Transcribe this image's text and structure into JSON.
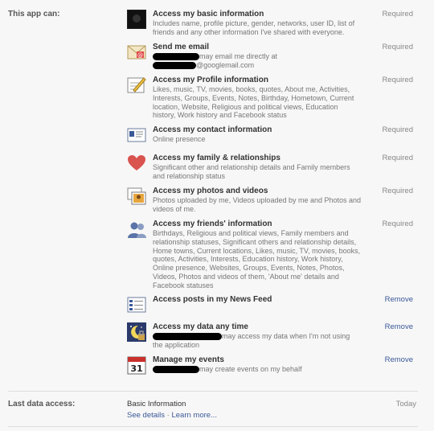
{
  "section_label": "This app can:",
  "permissions": [
    {
      "title": "Access my basic information",
      "desc": "Includes name, profile picture, gender, networks, user ID, list of friends and any other information I've shared with everyone.",
      "status": "Required"
    },
    {
      "title": "Send me email",
      "desc": "may email me directly at",
      "desc2": "@googlemail.com",
      "status": "Required"
    },
    {
      "title": "Access my Profile information",
      "desc": "Likes, music, TV, movies, books, quotes, About me, Activities, Interests, Groups, Events, Notes, Birthday, Hometown, Current location, Website, Religious and political views, Education history, Work history and Facebook status",
      "status": "Required"
    },
    {
      "title": "Access my contact information",
      "desc": "Online presence",
      "status": "Required"
    },
    {
      "title": "Access my family & relationships",
      "desc": "Significant other and relationship details and Family members and relationship status",
      "status": "Required"
    },
    {
      "title": "Access my photos and videos",
      "desc": "Photos uploaded by me, Videos uploaded by me and Photos and videos of me.",
      "status": "Required"
    },
    {
      "title": "Access my friends' information",
      "desc": "Birthdays, Religious and political views, Family members and relationship statuses, Significant others and relationship details, Home towns, Current locations, Likes, music, TV, movies, books, quotes, Activities, Interests, Education history, Work history, Online presence, Websites, Groups, Events, Notes, Photos, Videos, Photos and videos of them, 'About me' details and Facebook statuses",
      "status": "Required"
    },
    {
      "title": "Access posts in my News Feed",
      "desc": "",
      "status": "Remove"
    },
    {
      "title": "Access my data any time",
      "desc": "may access my data when I'm not using the application",
      "status": "Remove"
    },
    {
      "title": "Manage my events",
      "desc": "may create events on my behalf",
      "status": "Remove"
    }
  ],
  "calendar_day": "31",
  "footer": {
    "label": "Last data access:",
    "info": "Basic Information",
    "see_details": "See details",
    "separator": " · ",
    "learn_more": "Learn more...",
    "time": "Today"
  }
}
